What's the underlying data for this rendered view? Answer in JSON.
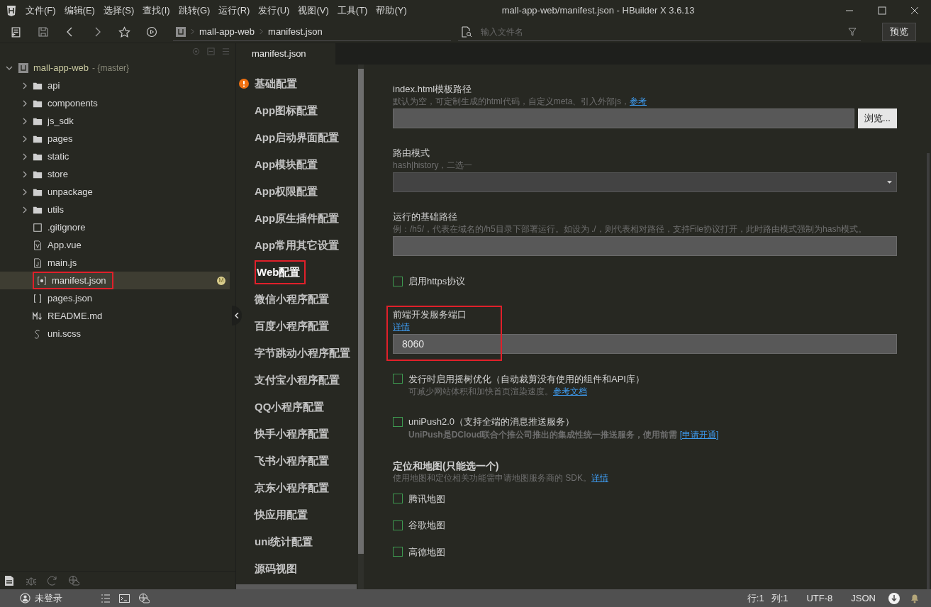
{
  "menu": [
    "文件(F)",
    "编辑(E)",
    "选择(S)",
    "查找(I)",
    "跳转(G)",
    "运行(R)",
    "发行(U)",
    "视图(V)",
    "工具(T)",
    "帮助(Y)"
  ],
  "window": {
    "title": "mall-app-web/manifest.json - HBuilder X 3.6.13"
  },
  "toolbar": {
    "breadcrumb": [
      "mall-app-web",
      "manifest.json"
    ],
    "search": {
      "placeholder": "输入文件名"
    },
    "preview_button": "预览"
  },
  "project": {
    "name": "mall-app-web",
    "branch": "- {master}",
    "expanded": true,
    "children": [
      {
        "name": "api",
        "kind": "folder",
        "expanded": false,
        "selected": false
      },
      {
        "name": "components",
        "kind": "folder",
        "expanded": false,
        "selected": false
      },
      {
        "name": "js_sdk",
        "kind": "folder",
        "expanded": false,
        "selected": false
      },
      {
        "name": "pages",
        "kind": "folder",
        "expanded": false,
        "selected": false
      },
      {
        "name": "static",
        "kind": "folder",
        "expanded": false,
        "selected": false
      },
      {
        "name": "store",
        "kind": "folder",
        "expanded": false,
        "selected": false
      },
      {
        "name": "unpackage",
        "kind": "folder",
        "expanded": false,
        "selected": false
      },
      {
        "name": "utils",
        "kind": "folder",
        "expanded": false,
        "selected": false
      },
      {
        "name": ".gitignore",
        "kind": "file",
        "selected": false
      },
      {
        "name": "App.vue",
        "kind": "vue",
        "selected": false
      },
      {
        "name": "main.js",
        "kind": "js",
        "selected": false
      },
      {
        "name": "manifest.json",
        "kind": "manifest",
        "selected": true,
        "badge": "M",
        "annotated": true
      },
      {
        "name": "pages.json",
        "kind": "json",
        "selected": false
      },
      {
        "name": "README.md",
        "kind": "markdown",
        "selected": false
      },
      {
        "name": "uni.scss",
        "kind": "scss",
        "selected": false
      }
    ]
  },
  "editor_tab": {
    "label": "manifest.json"
  },
  "nav": [
    {
      "label": "基础配置",
      "selected": false,
      "warning": true
    },
    {
      "label": "App图标配置",
      "selected": false
    },
    {
      "label": "App启动界面配置",
      "selected": false
    },
    {
      "label": "App模块配置",
      "selected": false
    },
    {
      "label": "App权限配置",
      "selected": false
    },
    {
      "label": "App原生插件配置",
      "selected": false
    },
    {
      "label": "App常用其它设置",
      "selected": false
    },
    {
      "label": "Web配置",
      "selected": true,
      "annotated": true
    },
    {
      "label": "微信小程序配置",
      "selected": false
    },
    {
      "label": "百度小程序配置",
      "selected": false
    },
    {
      "label": "字节跳动小程序配置",
      "selected": false
    },
    {
      "label": "支付宝小程序配置",
      "selected": false
    },
    {
      "label": "QQ小程序配置",
      "selected": false
    },
    {
      "label": "快手小程序配置",
      "selected": false
    },
    {
      "label": "飞书小程序配置",
      "selected": false
    },
    {
      "label": "京东小程序配置",
      "selected": false
    },
    {
      "label": "快应用配置",
      "selected": false
    },
    {
      "label": "uni统计配置",
      "selected": false
    },
    {
      "label": "源码视图",
      "selected": false
    }
  ],
  "form": [
    {
      "kind": "text-field",
      "label": "index.html模板路径",
      "hint": "默认为空，可定制生成的html代码，自定义meta、引入外部js，",
      "link": "参考",
      "button": "浏览..."
    },
    {
      "kind": "select",
      "label": "路由模式",
      "hint": "hash|history，二选一"
    },
    {
      "kind": "text-field",
      "label": "运行的基础路径",
      "hint": "例：/h5/，代表在域名的/h5目录下部署运行。如设为 ./，则代表相对路径，支持File协议打开，此时路由模式强制为hash模式。"
    },
    {
      "kind": "checkbox",
      "label": "启用https协议",
      "checked": false
    },
    {
      "kind": "text-field",
      "label": "前端开发服务端口",
      "link": "详情",
      "value": "8060",
      "annotated": true
    },
    {
      "kind": "checkbox",
      "label": "发行时启用摇树优化（自动裁剪没有使用的组件和API库）",
      "hint": "可减少网站体积和加快首页渲染速度。",
      "link": "参考文档",
      "checked": false
    },
    {
      "kind": "checkbox",
      "label": "uniPush2.0（支持全端的消息推送服务）",
      "hint": "UniPush是DCloud联合个推公司推出的集成性统一推送服务，使用前需 ",
      "hint_bold": true,
      "link": "[申请开通]",
      "checked": false
    },
    {
      "kind": "section",
      "label": "定位和地图(只能选一个)",
      "hint": "使用地图和定位相关功能需申请地图服务商的 SDK。",
      "link": "详情"
    },
    {
      "kind": "checkbox",
      "label": "腾讯地图",
      "checked": false
    },
    {
      "kind": "checkbox",
      "label": "谷歌地图",
      "checked": false
    },
    {
      "kind": "checkbox",
      "label": "高德地图",
      "checked": false
    }
  ],
  "status_bar": {
    "user": "未登录",
    "line": "行:1",
    "column": "列:1",
    "encoding": "UTF-8",
    "language": "JSON"
  }
}
